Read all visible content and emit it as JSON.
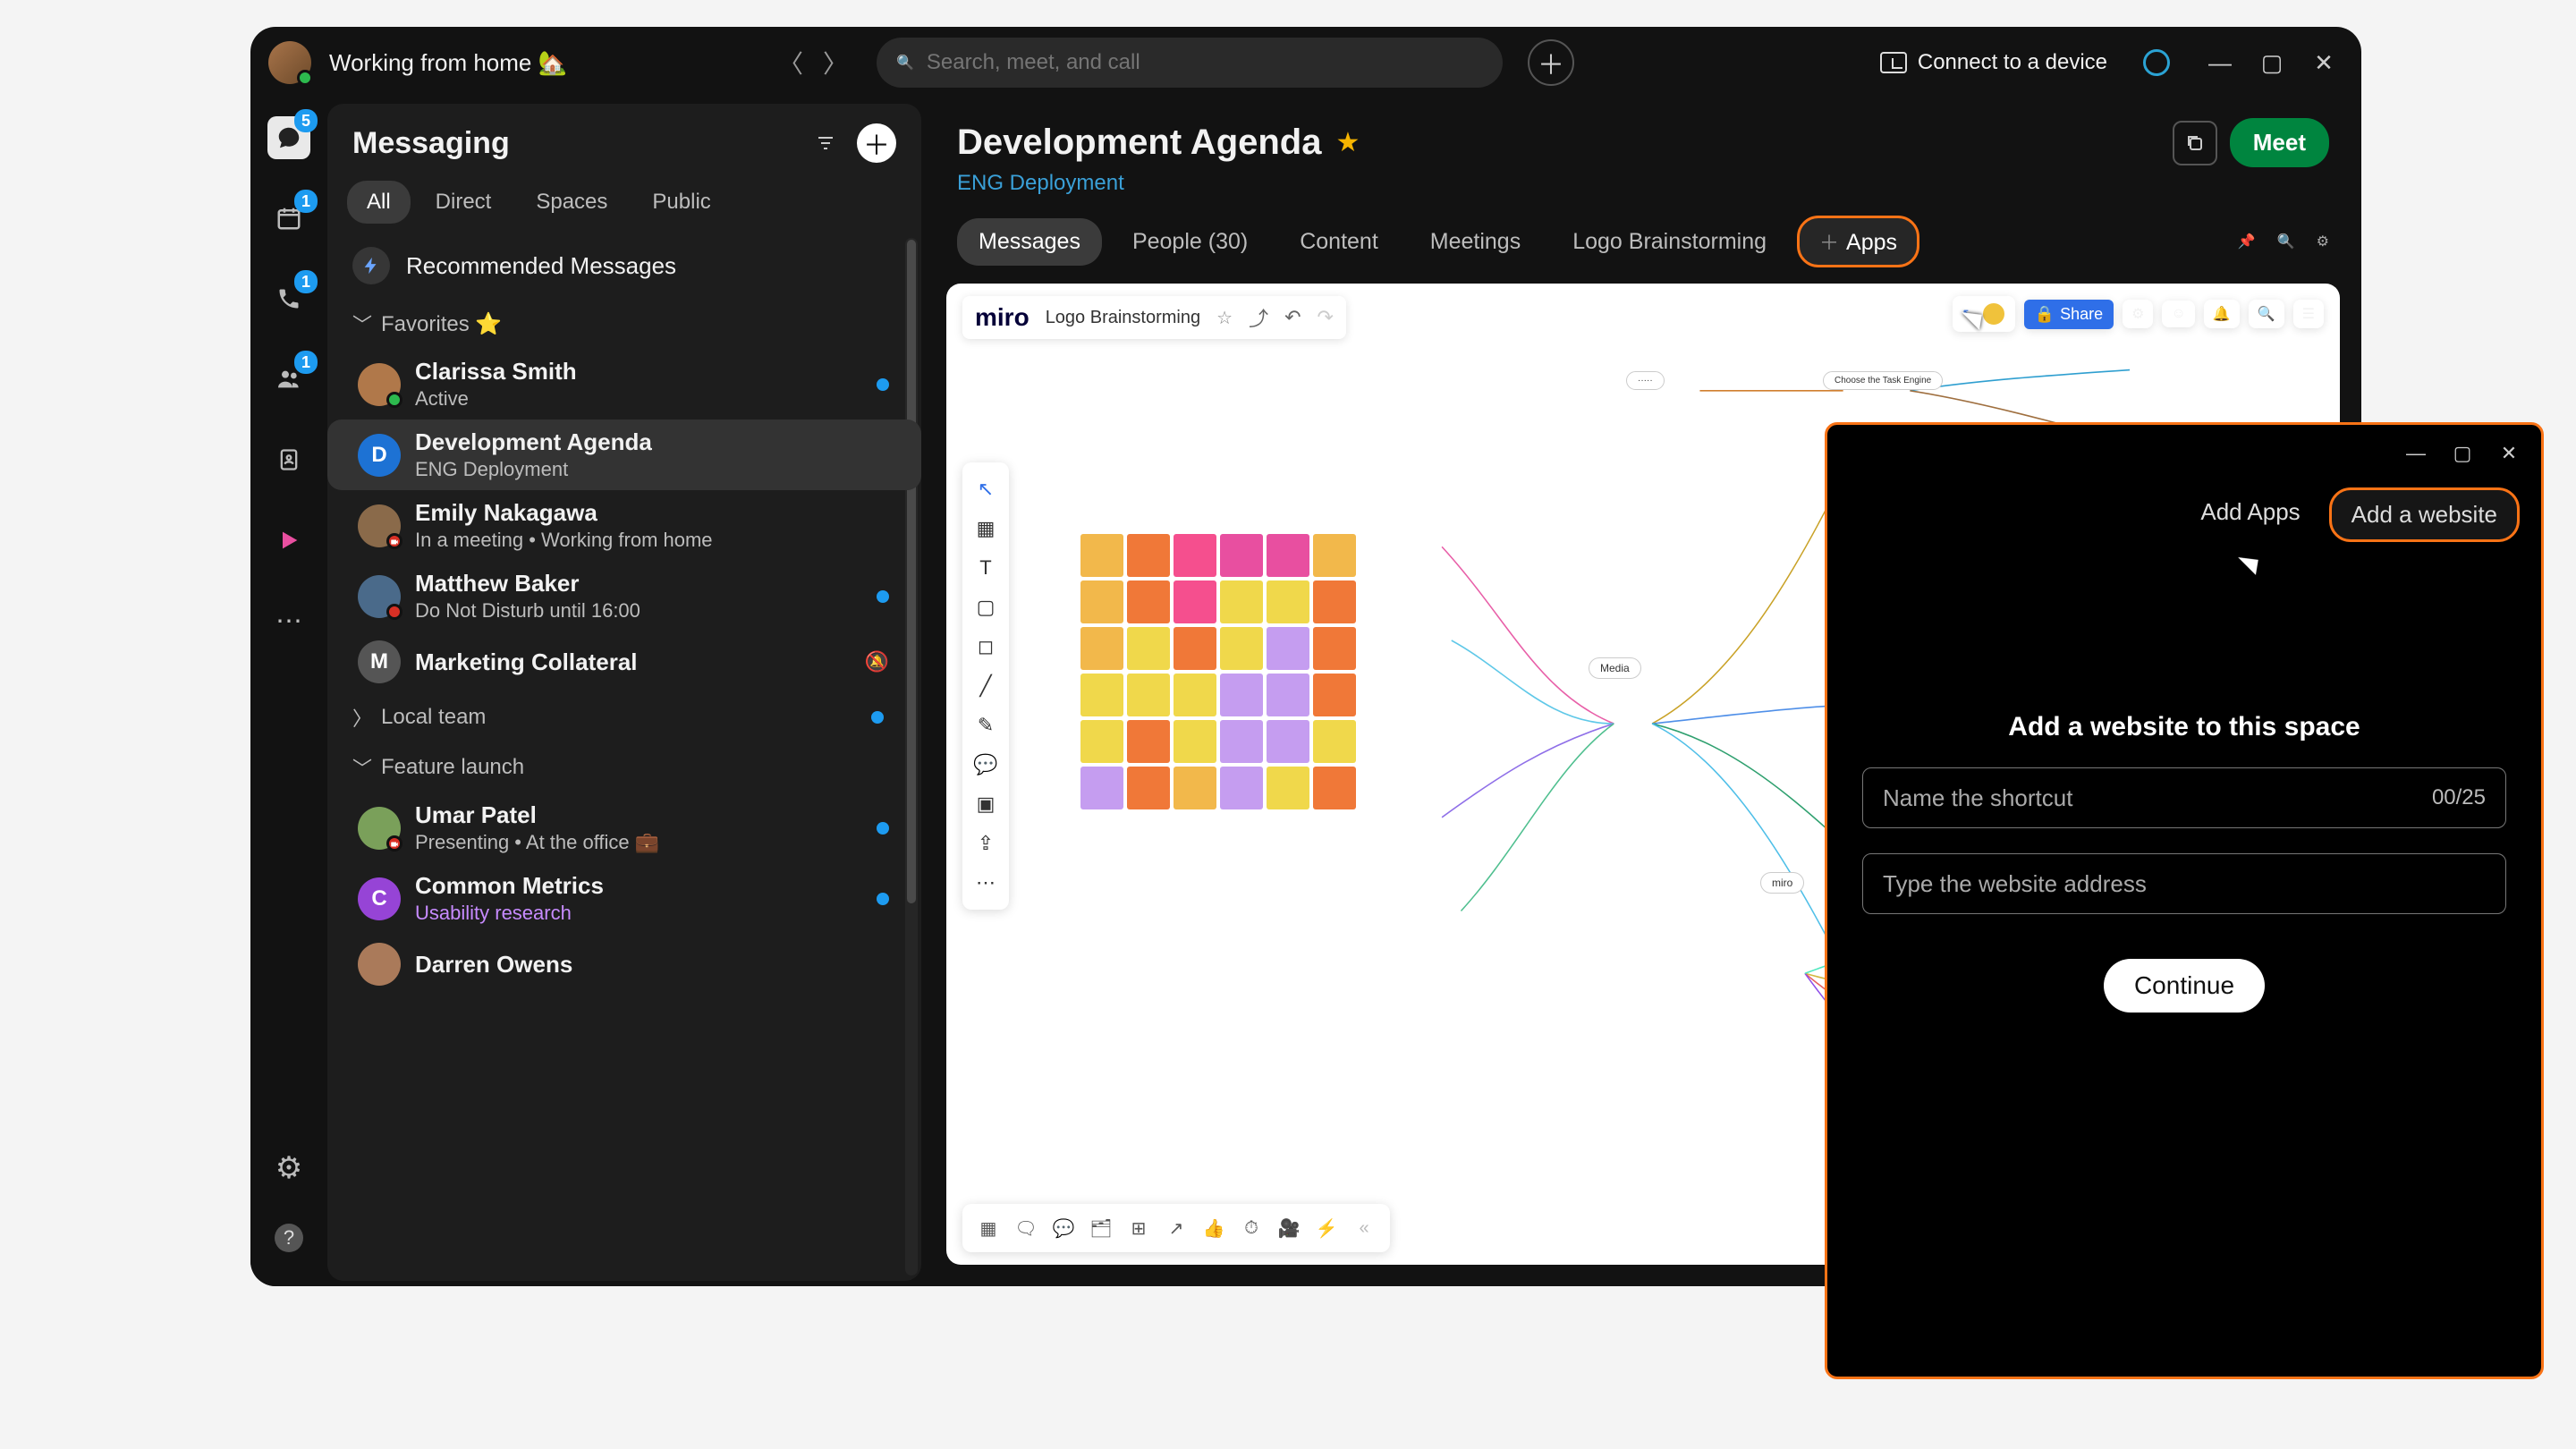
{
  "topbar": {
    "status": "Working from home 🏡",
    "search_placeholder": "Search, meet, and call",
    "connect": "Connect to a device"
  },
  "rail": {
    "items": [
      {
        "name": "chat",
        "badge": "5",
        "active": true
      },
      {
        "name": "calendar",
        "badge": "1"
      },
      {
        "name": "calls",
        "badge": "1"
      },
      {
        "name": "teams",
        "badge": "1"
      },
      {
        "name": "contacts"
      },
      {
        "name": "triangle"
      },
      {
        "name": "more"
      }
    ]
  },
  "sidebar": {
    "title": "Messaging",
    "tabs": [
      "All",
      "Direct",
      "Spaces",
      "Public"
    ],
    "active_tab": "All",
    "recommended": "Recommended Messages",
    "sections": {
      "favorites": "Favorites ⭐",
      "local_team": "Local team",
      "feature_launch": "Feature launch"
    },
    "favorites": [
      {
        "name": "Clarissa Smith",
        "sub": "Active",
        "dot": true,
        "status": "green",
        "av": "#b0784a"
      },
      {
        "name": "Development Agenda",
        "sub": "ENG Deployment",
        "selected": true,
        "letter": "D",
        "letterbg": "#1d72d4"
      },
      {
        "name": "Emily Nakagawa",
        "sub": "In a meeting  •  Working from home",
        "status": "camera",
        "av": "#8a6a4a"
      },
      {
        "name": "Matthew Baker",
        "sub": "Do Not Disturb until 16:00",
        "dot": true,
        "status": "red",
        "av": "#4a6a8a"
      },
      {
        "name": "Marketing Collateral",
        "letter": "M",
        "letterbg": "#555",
        "bell": true
      }
    ],
    "local_team_dot": true,
    "feature": [
      {
        "name": "Umar Patel",
        "sub": "Presenting  •  At the office 💼",
        "dot": true,
        "status": "camera",
        "av": "#7aa05a"
      },
      {
        "name": "Common Metrics",
        "sub": "Usability research",
        "dot": true,
        "letter": "C",
        "letterbg": "#9644d6",
        "subcolor": "#c78bff"
      },
      {
        "name": "Darren Owens",
        "av": "#aa7a5a"
      }
    ]
  },
  "main": {
    "title": "Development Agenda",
    "subtitle": "ENG Deployment",
    "meet": "Meet",
    "tabs": [
      "Messages",
      "People (30)",
      "Content",
      "Meetings",
      "Logo Brainstorming"
    ],
    "active_tab": "Messages",
    "apps_tab": "Apps"
  },
  "miro": {
    "logo": "miro",
    "title": "Logo Brainstorming",
    "share": "Share",
    "center_node": "Media",
    "right_node": "miro"
  },
  "popup": {
    "tab_apps": "Add Apps",
    "tab_website": "Add a website",
    "heading": "Add a website to this space",
    "name_placeholder": "Name the shortcut",
    "counter": "00/25",
    "url_placeholder": "Type the website address",
    "continue": "Continue"
  },
  "sticky_colors": [
    "#f2b84b",
    "#f07838",
    "#f54f8e",
    "#e84fa0",
    "#e84fa0",
    "#f2b84b",
    "#f2b84b",
    "#f07838",
    "#f54f8e",
    "#f0d84b",
    "#f0d84b",
    "#f07838",
    "#f2b84b",
    "#f0d84b",
    "#f07838",
    "#f0d84b",
    "#c59df0",
    "#f07838",
    "#f0d84b",
    "#f0d84b",
    "#f0d84b",
    "#c59df0",
    "#c59df0",
    "#f07838",
    "#f0d84b",
    "#f07838",
    "#f0d84b",
    "#c59df0",
    "#c59df0",
    "#f0d84b",
    "#c59df0",
    "#f07838",
    "#f2b84b",
    "#c59df0",
    "#f0d84b",
    "#f07838"
  ]
}
